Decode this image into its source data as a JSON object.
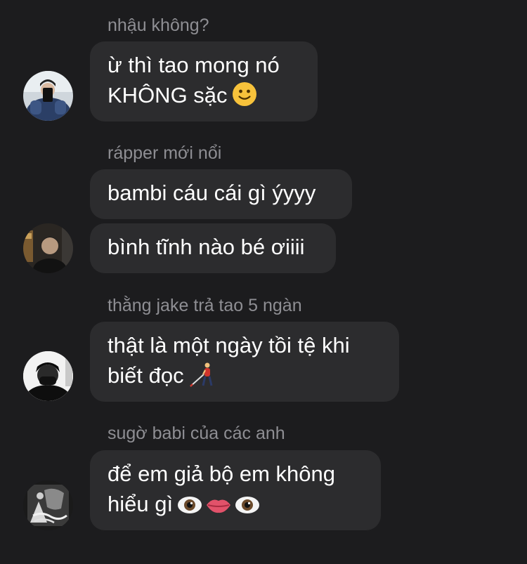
{
  "messages": [
    {
      "sender": "nhậu không?",
      "bubbles": [
        {
          "lines": [
            "ừ thì tao mong nó",
            "KHÔNG sặc"
          ],
          "trailing_emoji": "slightly-smiling-face-icon"
        }
      ]
    },
    {
      "sender": "rápper mới nổi",
      "bubbles": [
        {
          "lines": [
            "bambi cáu cái gì ýyyy"
          ]
        },
        {
          "lines": [
            "bình tĩnh nào bé ơiiii"
          ]
        }
      ]
    },
    {
      "sender": "thằng jake trả tao 5 ngàn",
      "bubbles": [
        {
          "lines": [
            "thật là một ngày tồi tệ khi",
            "biết đọc"
          ],
          "trailing_emoji": "person-with-white-cane-icon"
        }
      ]
    },
    {
      "sender": "sugờ babi của các anh",
      "bubbles": [
        {
          "lines": [
            "để em giả bộ em không",
            "hiểu gì"
          ],
          "trailing_emoji": "eye-mouth-eye-icons"
        }
      ]
    }
  ],
  "colors": {
    "background": "#1c1c1e",
    "bubble": "#2c2c2e",
    "sender_text": "#8e8e93",
    "message_text": "#ffffff"
  }
}
